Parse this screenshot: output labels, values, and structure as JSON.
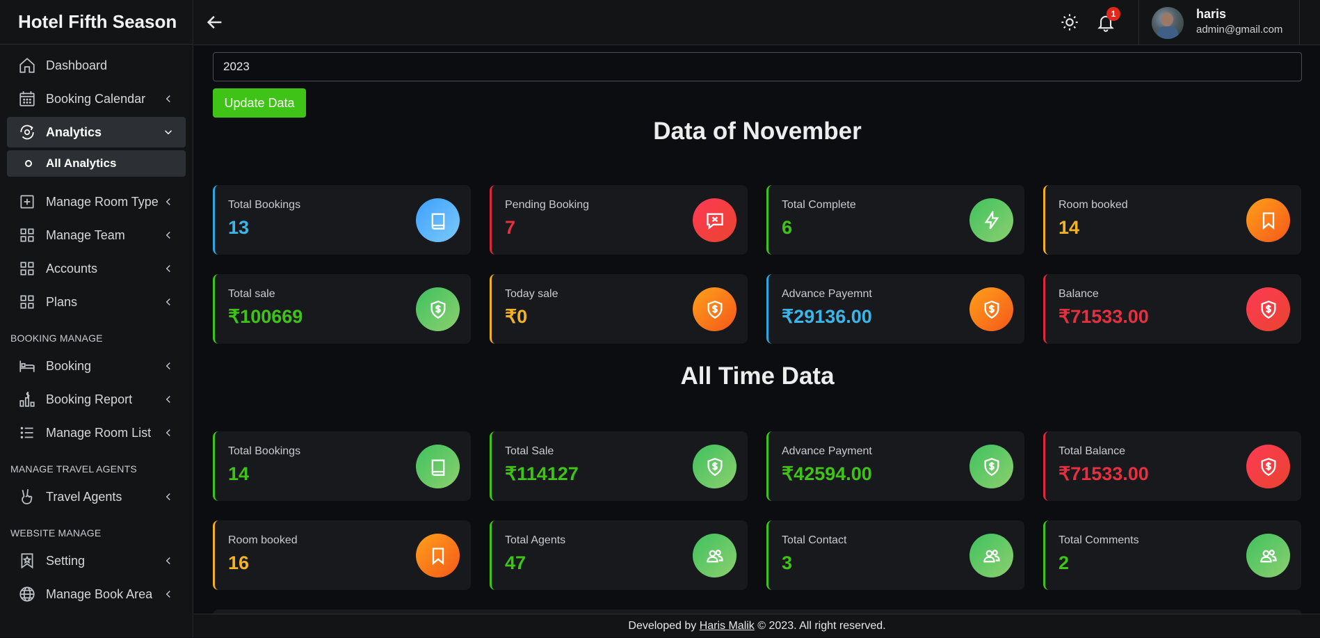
{
  "app": {
    "title": "Hotel Fifth Season"
  },
  "sidebar": {
    "items": [
      {
        "label": "Dashboard",
        "icon": "home-icon"
      },
      {
        "label": "Booking Calendar",
        "icon": "calendar-icon"
      },
      {
        "label": "Analytics",
        "icon": "analytics-icon"
      },
      {
        "label": "Manage Room Type",
        "icon": "plus-square-icon"
      },
      {
        "label": "Manage Team",
        "icon": "grid-icon"
      },
      {
        "label": "Accounts",
        "icon": "grid-icon"
      },
      {
        "label": "Plans",
        "icon": "grid-icon"
      },
      {
        "label": "Booking",
        "icon": "bed-icon"
      },
      {
        "label": "Booking Report",
        "icon": "report-icon"
      },
      {
        "label": "Manage Room List",
        "icon": "list-icon"
      },
      {
        "label": "Travel Agents",
        "icon": "hand-icon"
      },
      {
        "label": "Setting",
        "icon": "bookmark-star-icon"
      },
      {
        "label": "Manage Book Area",
        "icon": "globe-icon"
      }
    ],
    "sub_item": "All Analytics",
    "sections": {
      "booking": "BOOKING MANAGE",
      "travel": "MANAGE TRAVEL AGENTS",
      "website": "WEBSITE MANAGE"
    }
  },
  "header": {
    "notification_count": "1",
    "user_name": "haris",
    "user_email": "admin@gmail.com"
  },
  "filter": {
    "year_value": "2023",
    "update_label": "Update Data"
  },
  "monthly": {
    "heading": "Data of November",
    "cards": [
      {
        "label": "Total Bookings",
        "value": "13",
        "icon": "book-icon"
      },
      {
        "label": "Pending Booking",
        "value": "7",
        "icon": "message-x-icon"
      },
      {
        "label": "Total Complete",
        "value": "6",
        "icon": "lightning-icon"
      },
      {
        "label": "Room booked",
        "value": "14",
        "icon": "bookmark-icon"
      },
      {
        "label": "Total sale",
        "value": "₹100669",
        "icon": "shield-dollar-icon"
      },
      {
        "label": "Today sale",
        "value": "₹0",
        "icon": "shield-dollar-icon"
      },
      {
        "label": "Advance Payemnt",
        "value": "₹29136.00",
        "icon": "shield-dollar-icon"
      },
      {
        "label": "Balance",
        "value": "₹71533.00",
        "icon": "shield-dollar-icon"
      }
    ]
  },
  "alltime": {
    "heading": "All Time Data",
    "cards": [
      {
        "label": "Total Bookings",
        "value": "14",
        "icon": "book-icon"
      },
      {
        "label": "Total Sale",
        "value": "₹114127",
        "icon": "shield-dollar-icon"
      },
      {
        "label": "Advance Payment",
        "value": "₹42594.00",
        "icon": "shield-dollar-icon"
      },
      {
        "label": "Total Balance",
        "value": "₹71533.00",
        "icon": "shield-dollar-icon"
      },
      {
        "label": "Room booked",
        "value": "16",
        "icon": "bookmark-icon"
      },
      {
        "label": "Total Agents",
        "value": "47",
        "icon": "users-icon"
      },
      {
        "label": "Total Contact",
        "value": "3",
        "icon": "users-icon"
      },
      {
        "label": "Total Comments",
        "value": "2",
        "icon": "users-icon"
      }
    ]
  },
  "footer": {
    "prefix": "Developed by",
    "author": "Haris Malik",
    "suffix": "© 2023. All right reserved."
  },
  "colors": {
    "accent_green": "#3fc316",
    "blue": "#3bb6e8",
    "red": "#e6303f",
    "yellow": "#f3b323"
  }
}
